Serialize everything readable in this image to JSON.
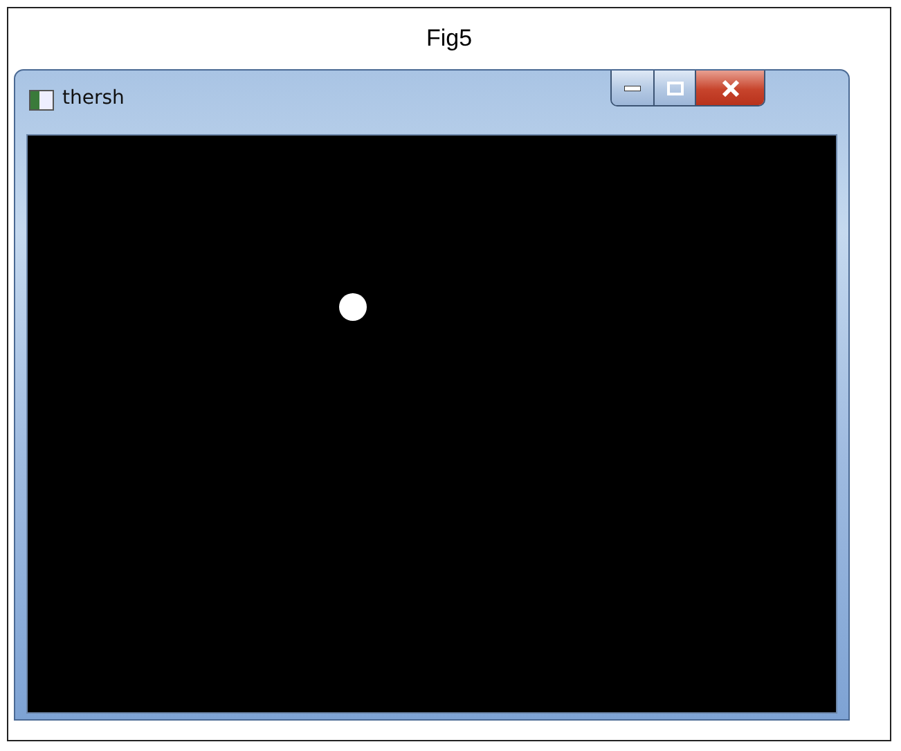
{
  "figure": {
    "caption": "Fig5"
  },
  "window": {
    "title": "thersh",
    "buttons": [
      {
        "kind": "minimize"
      },
      {
        "kind": "maximize"
      },
      {
        "kind": "close"
      }
    ]
  }
}
